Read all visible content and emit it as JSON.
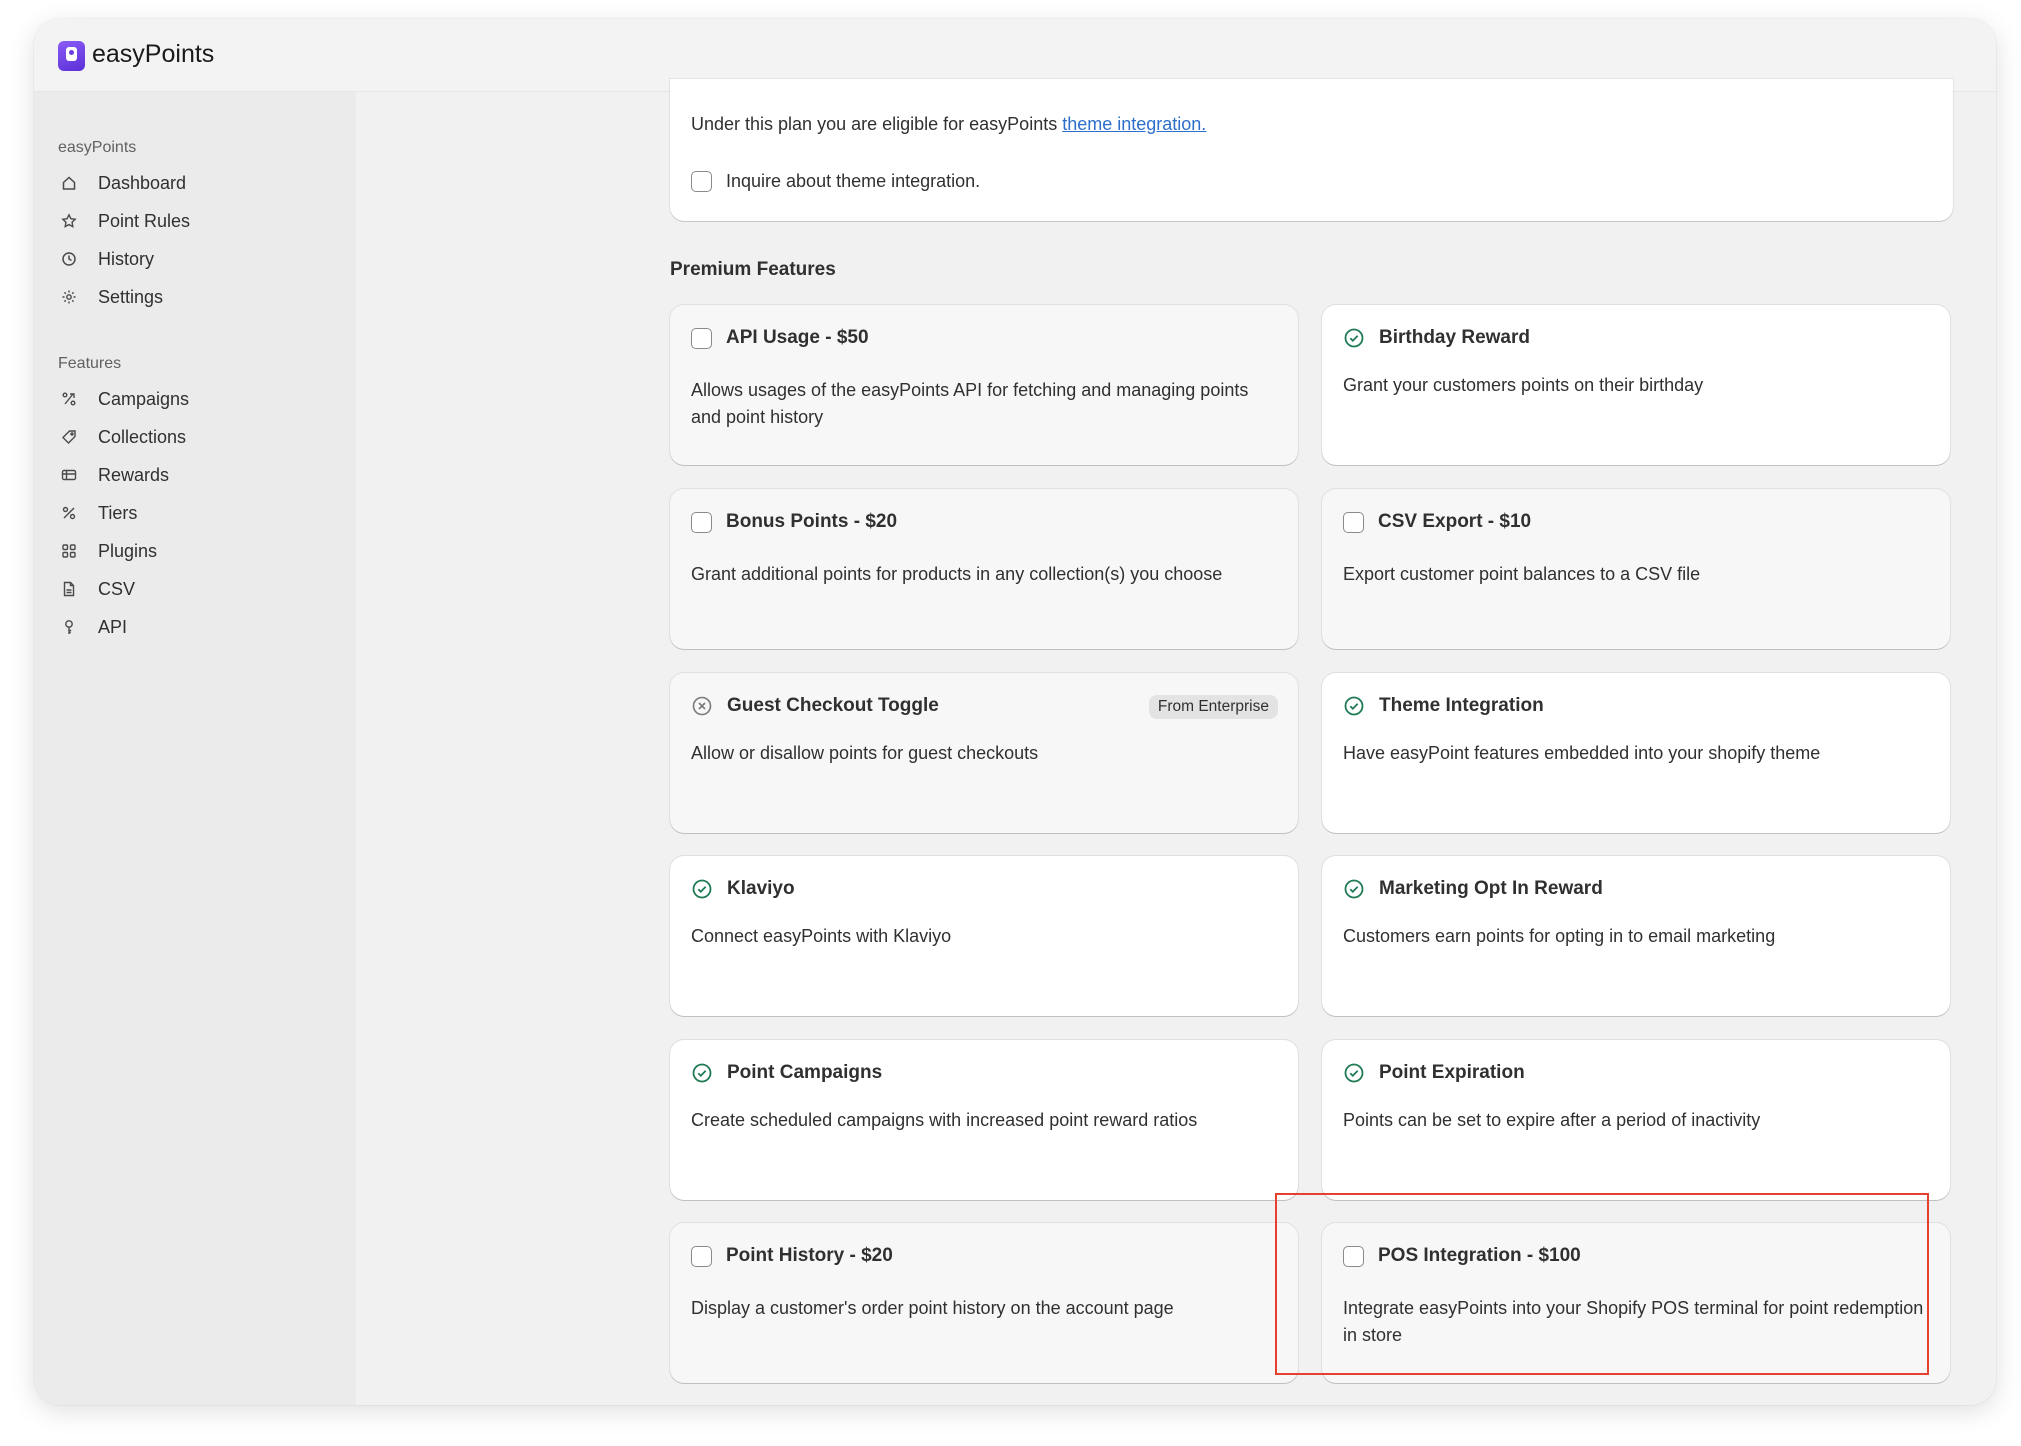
{
  "app": {
    "brand": "easyPoints"
  },
  "sidebar": {
    "sections": [
      {
        "title": "easyPoints",
        "items": [
          {
            "label": "Dashboard",
            "icon": "home-icon"
          },
          {
            "label": "Point Rules",
            "icon": "star-icon"
          },
          {
            "label": "History",
            "icon": "clock-icon"
          },
          {
            "label": "Settings",
            "icon": "gear-icon"
          }
        ]
      },
      {
        "title": "Features",
        "items": [
          {
            "label": "Campaigns",
            "icon": "campaign-icon"
          },
          {
            "label": "Collections",
            "icon": "tag-icon"
          },
          {
            "label": "Rewards",
            "icon": "gift-card-icon"
          },
          {
            "label": "Tiers",
            "icon": "percent-icon"
          },
          {
            "label": "Plugins",
            "icon": "apps-icon"
          },
          {
            "label": "CSV",
            "icon": "file-icon"
          },
          {
            "label": "API",
            "icon": "key-icon"
          }
        ]
      }
    ]
  },
  "plan": {
    "text": "Under this plan you are eligible for easyPoints ",
    "link": "theme integration.",
    "inquire_label": "Inquire about theme integration."
  },
  "premium": {
    "title": "Premium Features",
    "cards": [
      {
        "title": "API Usage - $50",
        "desc": "Allows usages of the easyPoints API for fetching and managing points and point history",
        "status": "checkbox"
      },
      {
        "title": "Birthday Reward",
        "desc": "Grant your customers points on their birthday",
        "status": "enabled"
      },
      {
        "title": "Bonus Points - $20",
        "desc": "Grant additional points for products in any collection(s) you choose",
        "status": "checkbox"
      },
      {
        "title": "CSV Export - $10",
        "desc": "Export customer point balances to a CSV file",
        "status": "checkbox"
      },
      {
        "title": "Guest Checkout Toggle",
        "desc": "Allow or disallow points for guest checkouts",
        "status": "unavailable",
        "badge": "From Enterprise"
      },
      {
        "title": "Theme Integration",
        "desc": "Have easyPoint features embedded into your shopify theme",
        "status": "enabled"
      },
      {
        "title": "Klaviyo",
        "desc": "Connect easyPoints with Klaviyo",
        "status": "enabled"
      },
      {
        "title": "Marketing Opt In Reward",
        "desc": "Customers earn points for opting in to email marketing",
        "status": "enabled"
      },
      {
        "title": "Point Campaigns",
        "desc": "Create scheduled campaigns with increased point reward ratios",
        "status": "enabled"
      },
      {
        "title": "Point Expiration",
        "desc": "Points can be set to expire after a period of inactivity",
        "status": "enabled"
      },
      {
        "title": "Point History - $20",
        "desc": "Display a customer's order point history on the account page",
        "status": "checkbox"
      },
      {
        "title": "POS Integration - $100",
        "desc": "Integrate easyPoints into your Shopify POS terminal for point redemption in store",
        "status": "checkbox",
        "highlighted": true
      }
    ]
  },
  "colors": {
    "enabled": "#1f7a55",
    "highlight": "#e5412e",
    "link": "#2c6ecb"
  }
}
